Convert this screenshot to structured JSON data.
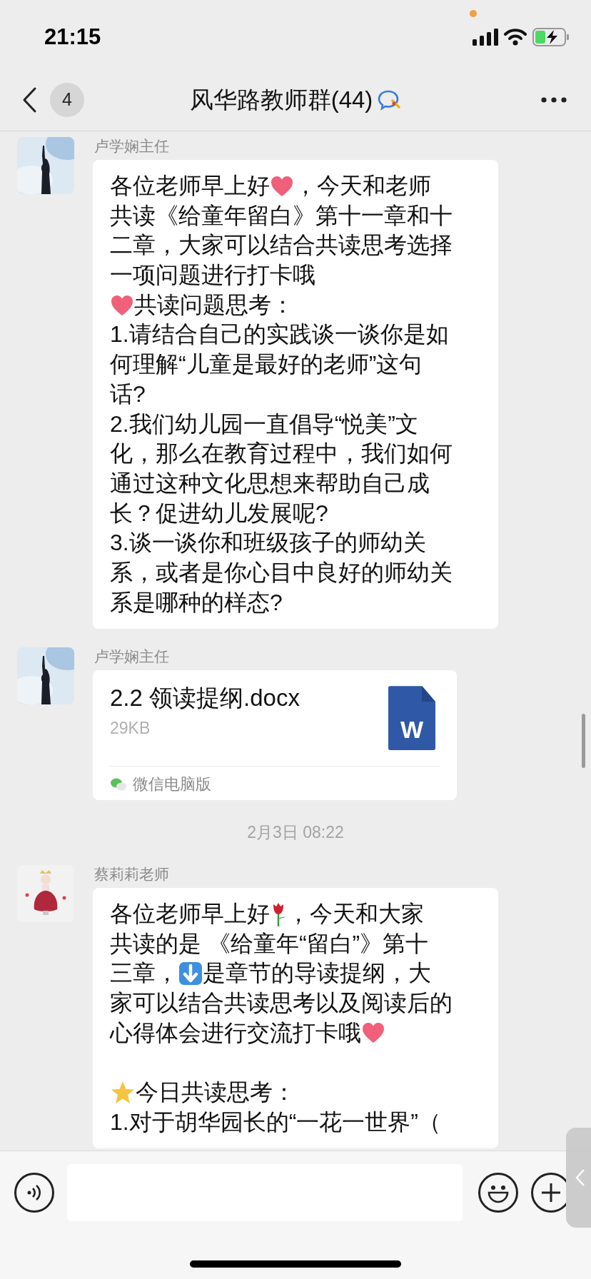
{
  "status_bar": {
    "time": "21:15"
  },
  "nav": {
    "unread_badge": "4",
    "title": "风华路教师群(44)"
  },
  "messages": [
    {
      "kind": "text",
      "sender": "卢学娴主任",
      "avatar": {
        "kind": "picture"
      },
      "blocks": [
        [
          [
            {
              "text": "各位老师早上好"
            },
            {
              "kind": "heart"
            },
            {
              "text": "，今天和老师"
            }
          ],
          [
            {
              "text": "共读《给童年留白》第十一章和十"
            }
          ],
          [
            {
              "text": "二章，大家可以结合共读思考选择"
            }
          ],
          [
            {
              "text": "一项问题进行打卡哦"
            }
          ],
          [
            {
              "kind": "heart"
            },
            {
              "text": "共读问题思考："
            }
          ],
          [
            {
              "text": "1.请结合自己的实践谈一谈你是如"
            }
          ],
          [
            {
              "text": "何理解“儿童是最好的老师”这句"
            }
          ],
          [
            {
              "text": "话?"
            }
          ],
          [
            {
              "text": "2.我们幼儿园一直倡导“悦美”文"
            }
          ],
          [
            {
              "text": "化，那么在教育过程中，我们如何"
            }
          ],
          [
            {
              "text": "通过这种文化思想来帮助自己成"
            }
          ],
          [
            {
              "text": "长？促进幼儿发展呢?"
            }
          ],
          [
            {
              "text": "3.谈一谈你和班级孩子的师幼关"
            }
          ],
          [
            {
              "text": "系，或者是你心目中良好的师幼关"
            }
          ],
          [
            {
              "text": "系是哪种的样态?"
            }
          ]
        ]
      ]
    },
    {
      "kind": "file",
      "sender": "卢学娴主任",
      "avatar": {
        "kind": "picture"
      },
      "file_name": "2.2 领读提纲.docx",
      "file_size": "29KB",
      "file_badge": "W",
      "source": "微信电脑版"
    },
    {
      "kind": "time",
      "text": "2月3日 08:22"
    },
    {
      "kind": "text",
      "sender": "蔡莉莉老师",
      "avatar": {
        "kind": "picture"
      },
      "blocks": [
        [
          [
            {
              "text": "各位老师早上好"
            },
            {
              "kind": "rose"
            },
            {
              "text": "，今天和大家"
            }
          ],
          [
            {
              "text": "共读的是 《给童年“留白”》第十"
            }
          ],
          [
            {
              "text": "三章，"
            },
            {
              "kind": "down"
            },
            {
              "text": "是章节的导读提纲，大"
            }
          ],
          [
            {
              "text": "家可以结合共读思考以及阅读后的"
            }
          ],
          [
            {
              "text": "心得体会进行交流打卡哦"
            },
            {
              "kind": "heart"
            }
          ]
        ],
        [
          [
            {
              "kind": "star"
            },
            {
              "text": "今日共读思考："
            }
          ],
          [
            {
              "text": "1.对于胡华园长的“一花一世界”（"
            }
          ]
        ]
      ]
    }
  ]
}
